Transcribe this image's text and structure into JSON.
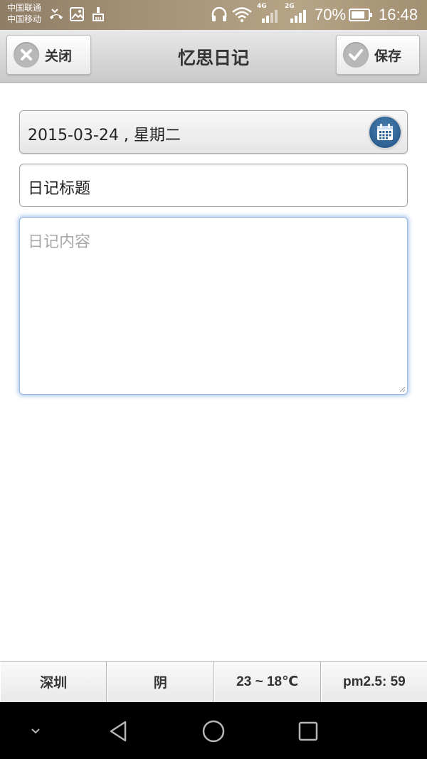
{
  "status_bar": {
    "carrier_1": "中国联通",
    "carrier_2": "中国移动",
    "network_4g": "4G",
    "network_2g": "2G",
    "battery": "70%",
    "time": "16:48"
  },
  "header": {
    "title": "忆思日记",
    "close_label": "关闭",
    "save_label": "保存"
  },
  "form": {
    "date_value": "2015-03-24 , 星期二",
    "title_value": "日记标题",
    "content_placeholder": "日记内容"
  },
  "weather": {
    "city": "深圳",
    "condition": "阴",
    "temperature": "23 ~ 18℃",
    "pm25": "pm2.5: 59"
  },
  "colors": {
    "accent_focus": "#6ea0e1",
    "calendar_blue": "#1d4f80"
  }
}
